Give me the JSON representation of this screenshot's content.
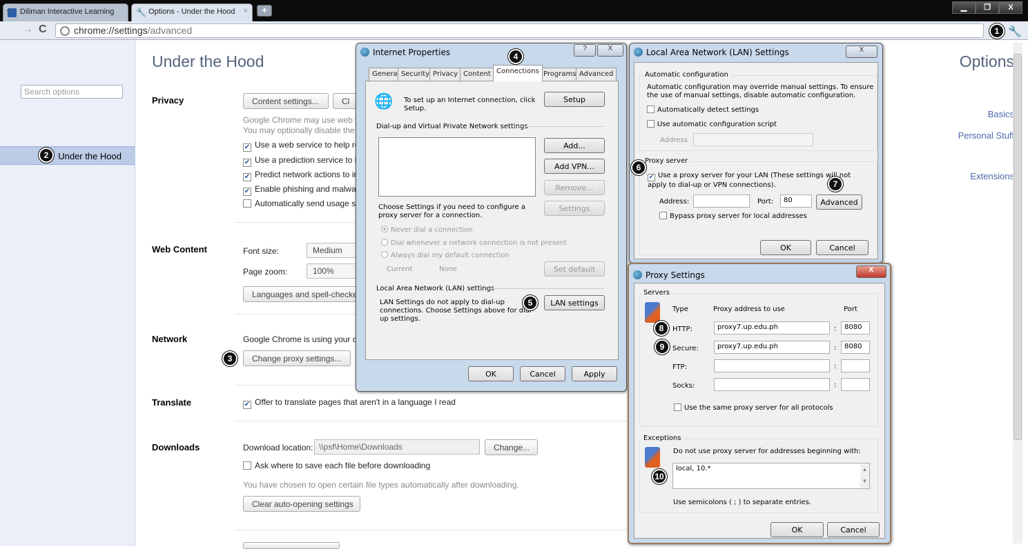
{
  "browser": {
    "tabs": [
      {
        "label": "Diliman Interactive Learning"
      },
      {
        "label": "Options - Under the Hood",
        "close": "×"
      }
    ],
    "url_prefix": "chrome://settings",
    "url_path": "/advanced",
    "new_tab": "+",
    "window_controls": {
      "minimize": "▁",
      "maximize": "❐",
      "close": "X"
    }
  },
  "sidebar": {
    "title": "Options",
    "search_placeholder": "Search options",
    "items": [
      "Basics",
      "Personal Stuff",
      "Under the Hood",
      "Extensions"
    ]
  },
  "page": {
    "title": "Under the Hood",
    "privacy": {
      "label": "Privacy",
      "content_settings": "Content settings...",
      "clear_button": "Cl",
      "desc1": "Google Chrome may use web s",
      "desc2": "You may optionally disable the",
      "checks": [
        "Use a web service to help re",
        "Use a prediction service to h",
        "Predict network actions to in",
        "Enable phishing and malwar",
        "Automatically send usage s"
      ]
    },
    "web_content": {
      "label": "Web Content",
      "font_size_label": "Font size:",
      "font_size_value": "Medium",
      "page_zoom_label": "Page zoom:",
      "page_zoom_value": "100%",
      "languages_button": "Languages and spell-checke"
    },
    "network": {
      "label": "Network",
      "desc": "Google Chrome is using your c",
      "proxy_button": "Change proxy settings..."
    },
    "translate": {
      "label": "Translate",
      "check": "Offer to translate pages that aren't in a language I read"
    },
    "downloads": {
      "label": "Downloads",
      "location_label": "Download location:",
      "location_value": "\\\\psf\\Home\\Downloads",
      "change_button": "Change...",
      "ask_check": "Ask where to save each file before downloading",
      "auto_open_text": "You have chosen to open certain file types automatically after downloading.",
      "clear_auto_button": "Clear auto-opening settings"
    }
  },
  "internet_properties": {
    "title": "Internet Properties",
    "help": "?",
    "close": "X",
    "tabs": [
      "General",
      "Security",
      "Privacy",
      "Content",
      "Connections",
      "Programs",
      "Advanced"
    ],
    "setup_text": "To set up an Internet connection, click Setup.",
    "setup_button": "Setup",
    "dialup_group": "Dial-up and Virtual Private Network settings",
    "add_button": "Add...",
    "add_vpn_button": "Add VPN...",
    "remove_button": "Remove...",
    "settings_text": "Choose Settings if you need to configure a proxy server for a connection.",
    "settings_button": "Settings",
    "radios": [
      "Never dial a connection",
      "Dial whenever a network connection is not present",
      "Always dial my default connection"
    ],
    "current_label": "Current",
    "current_value": "None",
    "set_default_button": "Set default",
    "lan_group": "Local Area Network (LAN) settings",
    "lan_text": "LAN Settings do not apply to dial-up connections. Choose Settings above for dial-up settings.",
    "lan_button": "LAN settings",
    "ok": "OK",
    "cancel": "Cancel",
    "apply": "Apply"
  },
  "lan_settings": {
    "title": "Local Area Network (LAN) Settings",
    "close": "X",
    "auto_group": "Automatic configuration",
    "auto_desc": "Automatic configuration may override manual settings.  To ensure the use of manual settings, disable automatic configuration.",
    "auto_detect": "Automatically detect settings",
    "auto_script": "Use automatic configuration script",
    "address_label": "Address",
    "proxy_group": "Proxy server",
    "use_proxy": "Use a proxy server for your LAN (These settings will not apply to dial-up or VPN connections).",
    "proxy_address_label": "Address:",
    "port_label": "Port:",
    "port_value": "80",
    "advanced_button": "Advanced",
    "bypass": "Bypass proxy server for local addresses",
    "ok": "OK",
    "cancel": "Cancel"
  },
  "proxy_settings": {
    "title": "Proxy Settings",
    "close": "X",
    "servers_group": "Servers",
    "col_type": "Type",
    "col_address": "Proxy address to use",
    "col_port": "Port",
    "rows": [
      {
        "type": "HTTP:",
        "address": "proxy7.up.edu.ph",
        "port": "8080"
      },
      {
        "type": "Secure:",
        "address": "proxy7.up.edu.ph",
        "port": "8080"
      },
      {
        "type": "FTP:",
        "address": "",
        "port": ""
      },
      {
        "type": "Socks:",
        "address": "",
        "port": ""
      }
    ],
    "colon": ":",
    "same_proxy": "Use the same proxy server for all protocols",
    "exceptions_group": "Exceptions",
    "exceptions_desc": "Do not use proxy server for addresses beginning with:",
    "exceptions_value": "local, 10.*",
    "semicolon_note": "Use semicolons ( ; ) to separate entries.",
    "ok": "OK",
    "cancel": "Cancel"
  },
  "callouts": [
    "1",
    "2",
    "3",
    "4",
    "5",
    "6",
    "7",
    "8",
    "9",
    "10"
  ]
}
